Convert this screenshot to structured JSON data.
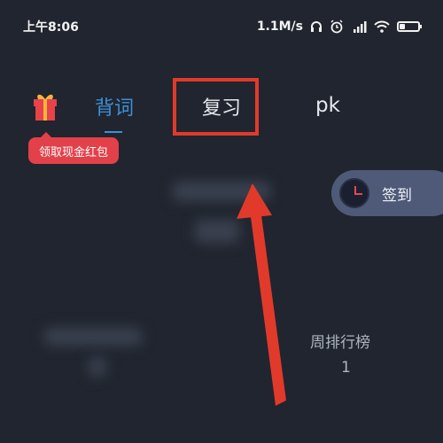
{
  "status_bar": {
    "time": "上午8:06",
    "network_speed": "1.1M/s",
    "icons": [
      "headphones-icon",
      "alarm-icon",
      "hd-signal-icon",
      "wifi-icon",
      "battery-icon"
    ],
    "battery_level": 0.3
  },
  "header": {
    "reward_label": "领取现金红包",
    "tabs": [
      {
        "label": "背词",
        "active": true
      },
      {
        "label": "复习",
        "active": false,
        "highlighted": true
      },
      {
        "label": "pk",
        "active": false
      }
    ]
  },
  "checkin": {
    "label": "签到",
    "icon": "clock-icon"
  },
  "stats": {
    "weekly_rank_label": "周排行榜",
    "weekly_rank_value": "1"
  },
  "colors": {
    "background": "#20252f",
    "active_tab": "#3d8fd6",
    "annotation_red": "#e13a2b",
    "reward_red": "#e2414a",
    "checkin_bg": "#4e5a78"
  }
}
